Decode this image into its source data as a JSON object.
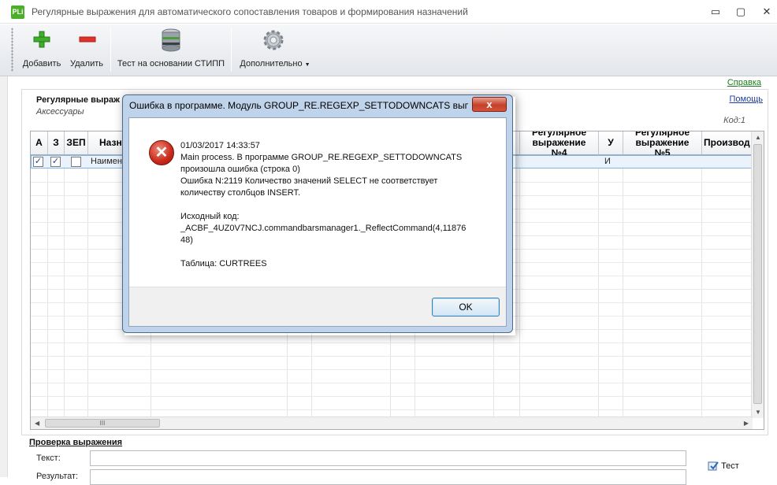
{
  "window": {
    "app_icon": "PLi",
    "title": "Регулярные выражения для автоматического сопоставления товаров и формирования назначений",
    "minimize": "▭",
    "maximize": "▢",
    "close": "✕"
  },
  "toolbar": {
    "add": "Добавить",
    "delete": "Удалить",
    "test_stipp": "Тест на основании СТИПП",
    "more": "Дополнительно"
  },
  "links": {
    "help": "Справка",
    "help2": "Помощь"
  },
  "section": {
    "title": "Регулярные выраж",
    "subtitle": "Аксессуары",
    "code": "Код:1"
  },
  "grid": {
    "columns": [
      {
        "label": "А"
      },
      {
        "label": "З"
      },
      {
        "label": "ЗЕП"
      },
      {
        "label": "Назн"
      },
      {
        "label": "Регулярное выражение №4"
      },
      {
        "label": "У"
      },
      {
        "label": "Регулярное выражение №5"
      },
      {
        "label": "Производ"
      }
    ],
    "row": {
      "a_checked": "✓",
      "z_checked": "✓",
      "name": "Наимено",
      "u": "И"
    },
    "hscroll_grip": "III"
  },
  "check": {
    "title": "Проверка выражения",
    "text_label": "Текст:",
    "result_label": "Результат:",
    "test_button": "Тест"
  },
  "dialog": {
    "title": "Ошибка в программе. Модуль GROUP_RE.REGEXP_SETTODOWNCATS выполн...",
    "close": "x",
    "icon": "✕",
    "lines": [
      "01/03/2017 14:33:57",
      "Main process. В программе GROUP_RE.REGEXP_SETTODOWNCATS",
      "произошла ошибка (строка 0)",
      "Ошибка N:2119 Количество значений SELECT не соответствует",
      "количеству столбцов INSERT.",
      "",
      "Исходный код:",
      "_ACBF_4UZ0V7NCJ.commandbarsmanager1._ReflectCommand(4,11876",
      "48)",
      "",
      "Таблица: CURTREES"
    ],
    "ok": "OK"
  }
}
